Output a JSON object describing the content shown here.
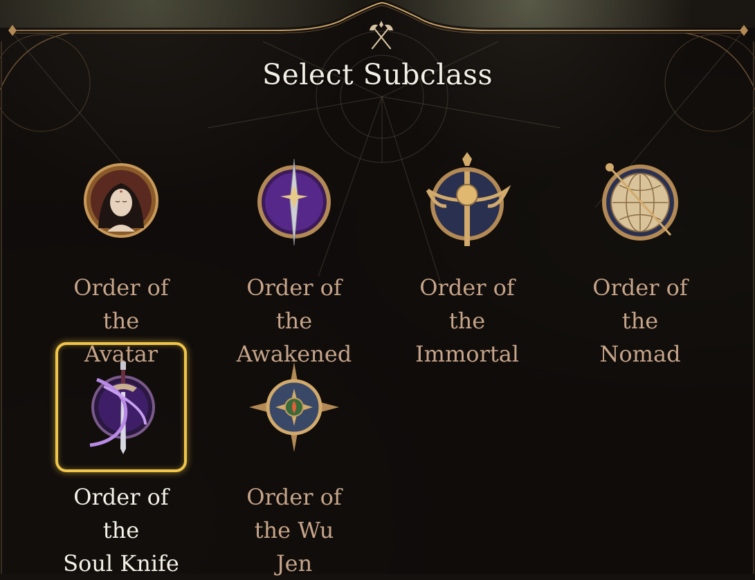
{
  "title": "Select Subclass",
  "subclasses": [
    {
      "name": "Order of the Avatar",
      "line1": "Order of the",
      "line2": "Avatar",
      "icon": "serene-woman-portrait-icon",
      "selected": false
    },
    {
      "name": "Order of the Awakened",
      "line1": "Order of the",
      "line2": "Awakened",
      "icon": "star-dagger-icon",
      "selected": false
    },
    {
      "name": "Order of the Immortal",
      "line1": "Order of the",
      "line2": "Immortal",
      "icon": "golden-scepter-icon",
      "selected": false
    },
    {
      "name": "Order of the Nomad",
      "line1": "Order of the",
      "line2": "Nomad",
      "icon": "globe-compass-icon",
      "selected": false
    },
    {
      "name": "Order of the Soul Knife",
      "line1": "Order of the",
      "line2": "Soul Knife",
      "icon": "psychic-blade-icon",
      "selected": true
    },
    {
      "name": "Order of the Wu Jen",
      "line1": "Order of the Wu",
      "line2": "Jen",
      "icon": "compass-star-flame-icon",
      "selected": false
    }
  ],
  "colors": {
    "label_default": "#c7a58a",
    "label_selected": "#f6f1e7",
    "selection_border": "#f0c64a",
    "frame_gold": "#b38a55"
  }
}
